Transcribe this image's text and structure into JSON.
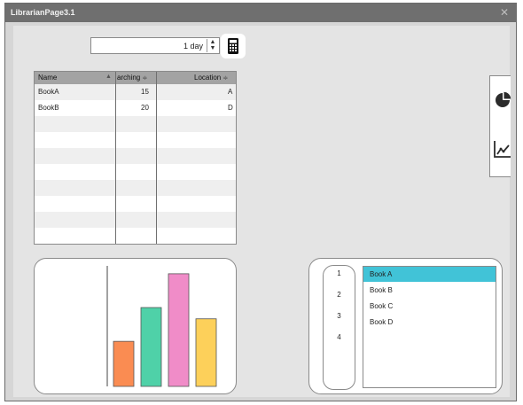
{
  "window": {
    "title": "LibrarianPage3.1",
    "close_glyph": "✕"
  },
  "stepper": {
    "value": "1 day",
    "spin_icon": "up-down-arrows-icon"
  },
  "calculator_button": {
    "icon": "calculator-icon"
  },
  "grid": {
    "columns": [
      {
        "label": "Name",
        "sort_glyph": "▲"
      },
      {
        "label": "arching",
        "sort_glyph": "≑"
      },
      {
        "label": "Location",
        "sort_glyph": "≑"
      }
    ],
    "rows": [
      {
        "name": "BookA",
        "searching": "15",
        "location": "A"
      },
      {
        "name": "BookB",
        "searching": "20",
        "location": "D"
      }
    ],
    "empty_rows": 8
  },
  "side_panel": {
    "icons": [
      "pie-chart-icon",
      "line-chart-icon"
    ]
  },
  "chart_data": {
    "type": "bar",
    "categories": [
      "",
      "",
      "",
      ""
    ],
    "values": [
      4,
      7,
      10,
      6
    ],
    "colors": [
      "#fa8c52",
      "#4fd1a8",
      "#f08cc8",
      "#fdd05a"
    ],
    "xlabel": "",
    "ylabel": "",
    "ylim": [
      0,
      10.7
    ],
    "grid": false
  },
  "list_panel": {
    "numbers": [
      "1",
      "2",
      "3",
      "4"
    ],
    "books": [
      "Book A",
      "Book B",
      "Book C",
      "Book D"
    ],
    "selected_index": 0,
    "selected_color": "#41c3d7"
  }
}
